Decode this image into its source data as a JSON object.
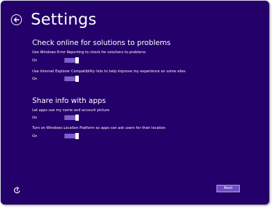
{
  "header": {
    "title": "Settings",
    "back_icon": "back-arrow-icon"
  },
  "sections": [
    {
      "heading": "Check online for solutions to problems",
      "settings": [
        {
          "description": "Use Windows Error Reporting to check for solutions to problems",
          "state": "On",
          "enabled": true
        },
        {
          "description": "Use Internet Explorer Compatibility lists to help improve my experience on some sites",
          "state": "On",
          "enabled": true
        }
      ]
    },
    {
      "heading": "Share info with apps",
      "settings": [
        {
          "description": "Let apps use my name and account picture",
          "state": "On",
          "enabled": true
        },
        {
          "description": "Turn on Windows Location Platform so apps can ask users for their location",
          "state": "On",
          "enabled": true
        }
      ]
    }
  ],
  "footer": {
    "ease_of_access_icon": "ease-of-access-icon",
    "next_label": "Next"
  },
  "colors": {
    "background": "#24006a",
    "toggle_track": "#7c5ec9",
    "toggle_thumb": "#ffffff",
    "button": "#6e4cc2"
  }
}
